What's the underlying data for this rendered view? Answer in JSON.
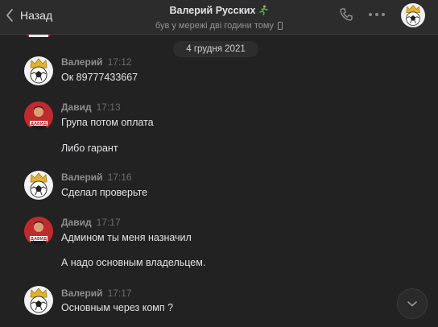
{
  "header": {
    "back_label": "Назад",
    "peer_name": "Валерий Русских",
    "peer_status": "був у мережі дві години тому"
  },
  "date_separator": "4 грудня 2021",
  "messages": [
    {
      "author": "Валерий",
      "time": "17:12",
      "avatar": "crown-football",
      "lines": [
        "Ок 89777433667"
      ]
    },
    {
      "author": "Давид",
      "time": "17:13",
      "avatar": "david-red",
      "lines": [
        "Група потом оплата",
        "Либо гарант"
      ]
    },
    {
      "author": "Валерий",
      "time": "17:16",
      "avatar": "crown-football",
      "lines": [
        "Сделал проверьте"
      ]
    },
    {
      "author": "Давид",
      "time": "17:17",
      "avatar": "david-red",
      "lines": [
        "Админом ты меня назначил",
        "А надо основным владельцем."
      ]
    },
    {
      "author": "Валерий",
      "time": "17:17",
      "avatar": "crown-football",
      "lines": [
        "Основным через комп ?"
      ]
    }
  ],
  "colors": {
    "background": "#222222",
    "header": "#2c2c2c",
    "text": "#e1e3e6",
    "author": "#8e8e8e",
    "time": "#6c6c6c"
  }
}
